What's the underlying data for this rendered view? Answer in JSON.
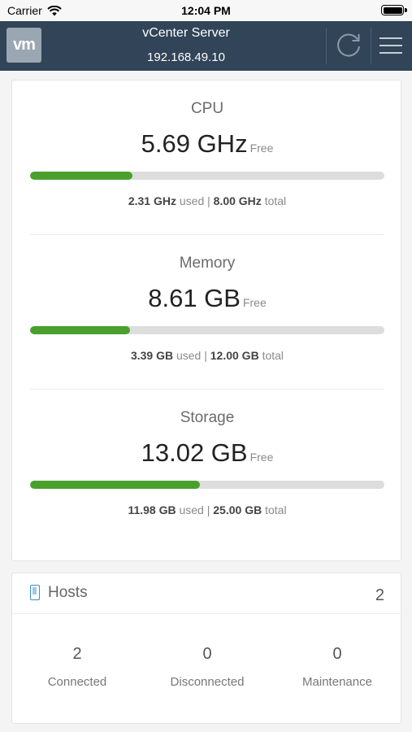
{
  "status_bar": {
    "carrier": "Carrier",
    "time": "12:04 PM"
  },
  "header": {
    "logo": "vm",
    "title": "vCenter Server",
    "subtitle": "192.168.49.10",
    "colors": {
      "background": "#314458"
    }
  },
  "resources": [
    {
      "name": "CPU",
      "free": "5.69 GHz",
      "free_label": "Free",
      "used": "2.31 GHz",
      "used_label": "used",
      "total": "8.00 GHz",
      "total_label": "total",
      "used_fraction": 0.289
    },
    {
      "name": "Memory",
      "free": "8.61 GB",
      "free_label": "Free",
      "used": "3.39 GB",
      "used_label": "used",
      "total": "12.00 GB",
      "total_label": "total",
      "used_fraction": 0.283
    },
    {
      "name": "Storage",
      "free": "13.02 GB",
      "free_label": "Free",
      "used": "11.98 GB",
      "used_label": "used",
      "total": "25.00 GB",
      "total_label": "total",
      "used_fraction": 0.479
    }
  ],
  "usage_separator": "|",
  "bar_color": "#4aa02c",
  "hosts": {
    "title": "Hosts",
    "count": "2",
    "stats": [
      {
        "value": "2",
        "label": "Connected"
      },
      {
        "value": "0",
        "label": "Disconnected"
      },
      {
        "value": "0",
        "label": "Maintenance"
      }
    ]
  },
  "icons": [
    "wifi-icon",
    "battery-icon",
    "refresh-icon",
    "menu-icon",
    "host-icon"
  ]
}
